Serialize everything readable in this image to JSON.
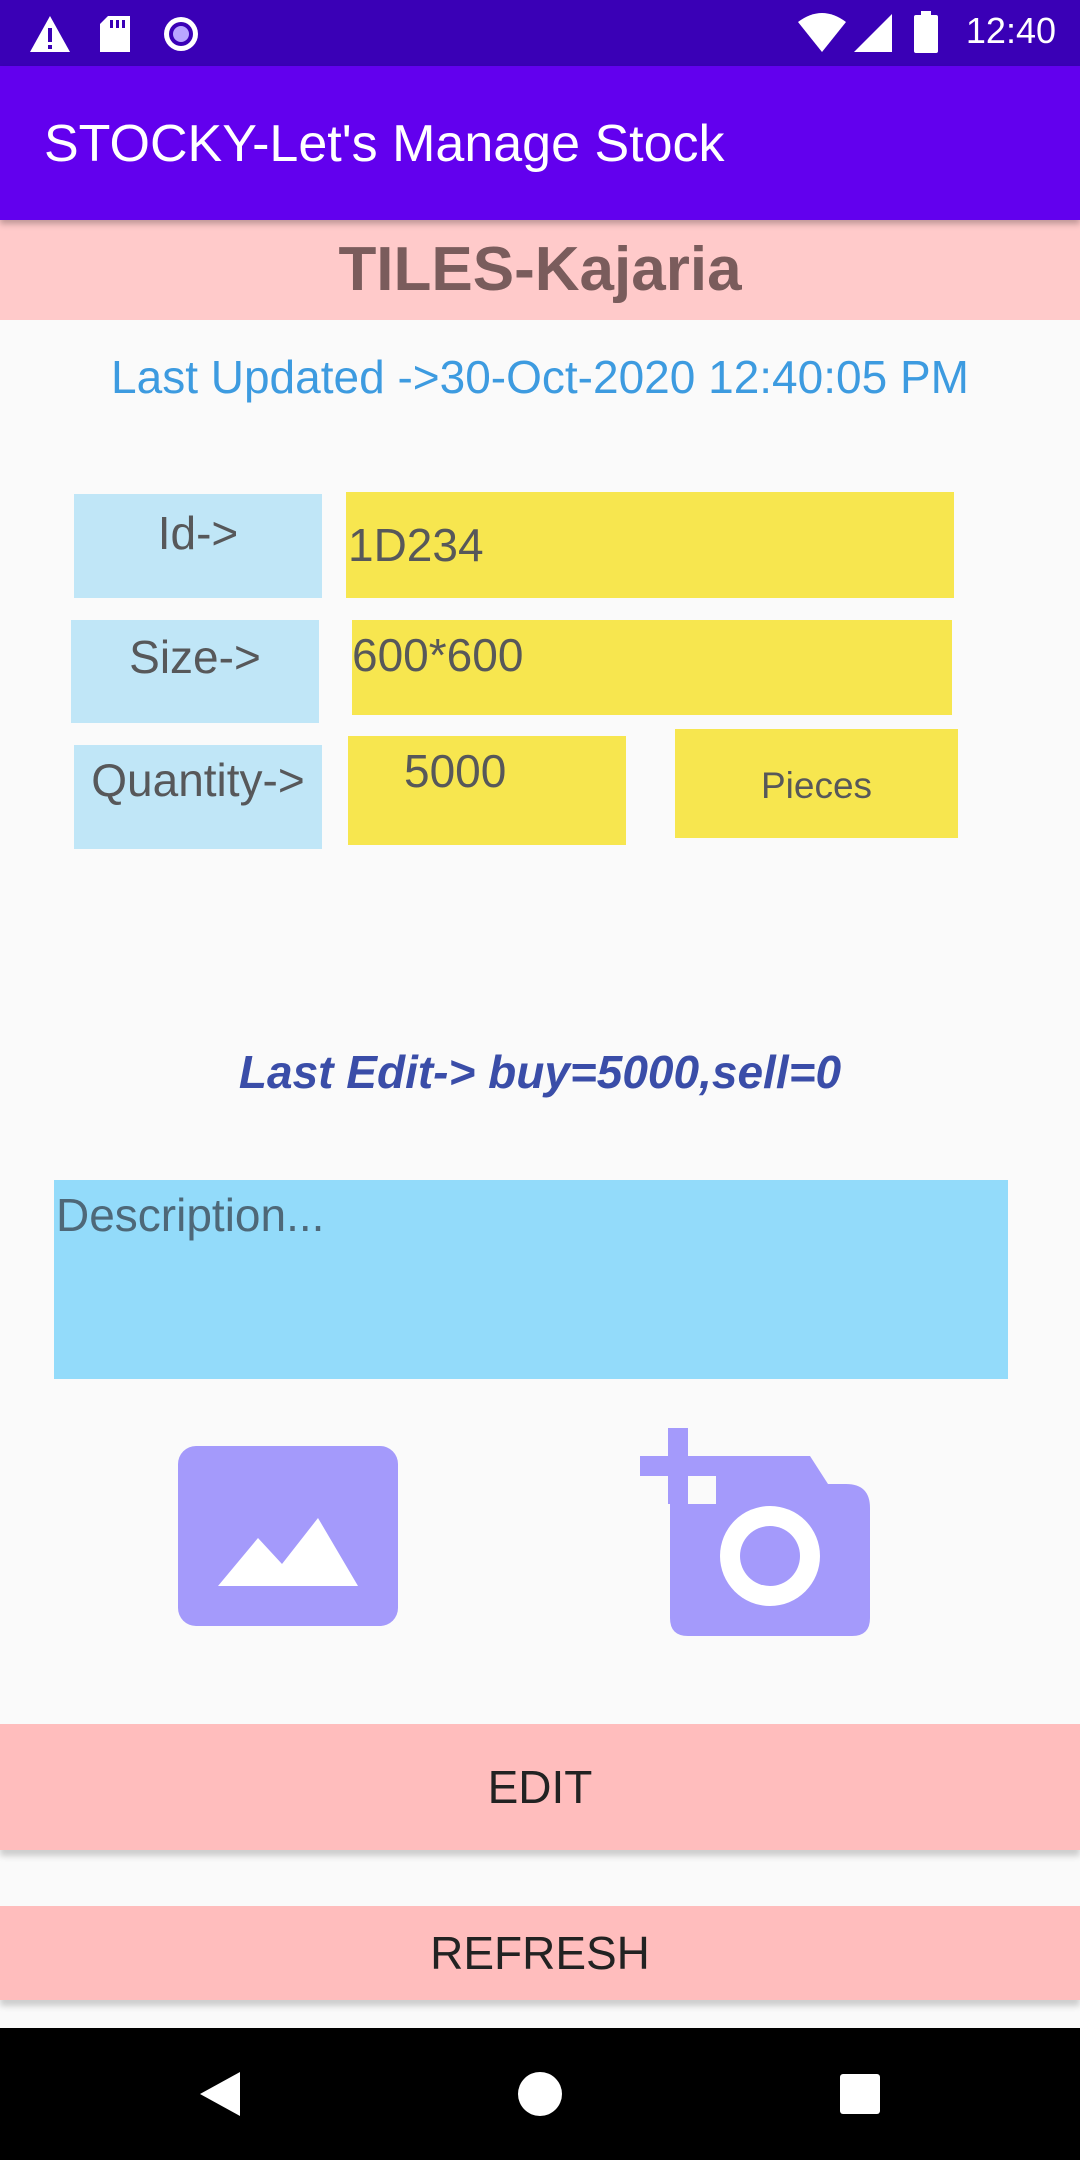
{
  "status_bar": {
    "time": "12:40",
    "left_icons": [
      "warning-icon",
      "sd-card-icon",
      "radio-circle-icon"
    ],
    "right_icons": [
      "wifi-icon",
      "cellular-signal-icon",
      "battery-icon"
    ]
  },
  "app_bar": {
    "title": "STOCKY-Let's Manage Stock"
  },
  "product": {
    "title": "TILES-Kajaria",
    "last_updated": "Last Updated ->30-Oct-2020  12:40:05 PM"
  },
  "fields": {
    "id_label": "Id->",
    "id_value": "1D234",
    "size_label": "Size->",
    "size_value": "600*600",
    "quantity_label": "Quantity->",
    "quantity_value": "5000",
    "unit_value": "Pieces"
  },
  "last_edit": "Last Edit-> buy=5000,sell=0",
  "description": {
    "placeholder": "Description...",
    "value": ""
  },
  "media": {
    "gallery_icon": "image-gallery-icon",
    "camera_icon": "add-photo-camera-icon"
  },
  "buttons": {
    "edit_label": "EDIT",
    "refresh_label": "REFRESH"
  },
  "nav_bar": {
    "icons": [
      "back-triangle-icon",
      "home-circle-icon",
      "recents-square-icon"
    ]
  },
  "colors": {
    "status_bar": "#3A00B6",
    "app_bar": "#6200EE",
    "title_strip": "#FFCACA",
    "label_box": "#C0E6F7",
    "value_box": "#F7E64F",
    "description_box": "#93DBFA",
    "button": "#FFBDBD",
    "icon_accent": "#A49AFB",
    "last_updated_text": "#3D9BE0",
    "last_edit_text": "#3A4DA8"
  }
}
